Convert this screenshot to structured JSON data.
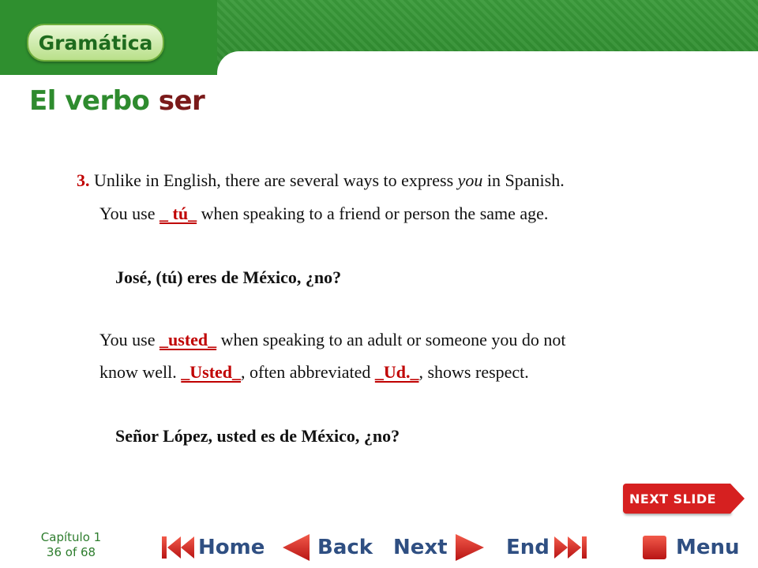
{
  "header": {
    "section_label": "Gramática"
  },
  "title": {
    "part1": "El verbo ",
    "part2": "ser"
  },
  "content": {
    "p1_num": "3.",
    "p1_a": " Unlike in English, there are several ways to express ",
    "p1_italic": "you",
    "p1_b": " in Spanish.",
    "p2_a": "You use ",
    "p2_blank": "_ tú_",
    "p2_b": " when speaking to a friend or person the same age.",
    "ex1": "José, (tú) eres de México, ¿no?",
    "p3_a": "You use ",
    "p3_blank": "_usted_",
    "p3_b": " when speaking to an adult or someone you do not",
    "p4_a": "know well. ",
    "p4_blank1": "_Usted_",
    "p4_b": ", often abbreviated ",
    "p4_blank2": "_Ud._",
    "p4_c": ", shows respect.",
    "ex2": "Señor López, usted es de México, ¿no?"
  },
  "next_slide": {
    "label": "NEXT SLIDE"
  },
  "footer": {
    "chapter": "Capítulo 1",
    "page": "36 of 68",
    "home": "Home",
    "back": "Back",
    "next": "Next",
    "end": "End",
    "menu": "Menu"
  },
  "colors": {
    "green": "#2e8b2e",
    "red": "#c00000",
    "nav_blue": "#2f4f82"
  },
  "icons": {
    "home": "first-page-icon",
    "back": "back-arrow-icon",
    "next": "next-arrow-icon",
    "end": "last-page-icon",
    "menu": "menu-square-icon"
  }
}
